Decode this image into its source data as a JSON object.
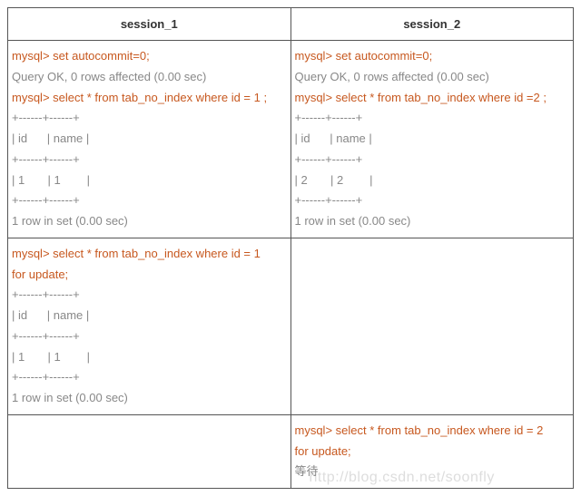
{
  "headers": {
    "col1": "session_1",
    "col2": "session_2"
  },
  "rows": [
    {
      "left": [
        {
          "cls": "cmd",
          "text": "mysql> set autocommit=0;"
        },
        {
          "cls": "gray",
          "text": "Query OK, 0 rows affected (0.00 sec)"
        },
        {
          "cls": "cmd",
          "text": "mysql> select * from tab_no_index where id = 1 ;"
        },
        {
          "cls": "gray",
          "text": "+------+------+"
        },
        {
          "cls": "gray",
          "text": "| id      | name |"
        },
        {
          "cls": "gray",
          "text": "+------+------+"
        },
        {
          "cls": "gray",
          "text": "| 1       | 1        |"
        },
        {
          "cls": "gray",
          "text": "+------+------+"
        },
        {
          "cls": "gray",
          "text": "1 row in set (0.00 sec)"
        }
      ],
      "right": [
        {
          "cls": "cmd",
          "text": "mysql> set autocommit=0;"
        },
        {
          "cls": "gray",
          "text": "Query OK, 0 rows affected (0.00 sec)"
        },
        {
          "cls": "cmd",
          "text": "mysql> select * from tab_no_index where id =2 ;"
        },
        {
          "cls": "gray",
          "text": "+------+------+"
        },
        {
          "cls": "gray",
          "text": "| id      | name |"
        },
        {
          "cls": "gray",
          "text": "+------+------+"
        },
        {
          "cls": "gray",
          "text": "| 2       | 2        |"
        },
        {
          "cls": "gray",
          "text": "+------+------+"
        },
        {
          "cls": "gray",
          "text": "1 row in set (0.00 sec)"
        }
      ]
    },
    {
      "left": [
        {
          "cls": "cmd",
          "text": "mysql> select * from tab_no_index where id = 1 "
        },
        {
          "cls": "cmd",
          "text": "for update;"
        },
        {
          "cls": "gray",
          "text": "+------+------+"
        },
        {
          "cls": "gray",
          "text": "| id      | name |"
        },
        {
          "cls": "gray",
          "text": "+------+------+"
        },
        {
          "cls": "gray",
          "text": "| 1       | 1        |"
        },
        {
          "cls": "gray",
          "text": "+------+------+"
        },
        {
          "cls": "gray",
          "text": "1 row in set (0.00 sec)"
        }
      ],
      "right": []
    },
    {
      "left": [],
      "right": [
        {
          "cls": "cmd",
          "text": "mysql> select * from tab_no_index where id = 2 "
        },
        {
          "cls": "cmd",
          "text": "for update;"
        },
        {
          "cls": "gray",
          "text": "等待"
        }
      ]
    }
  ],
  "watermark": "http://blog.csdn.net/soonfly"
}
